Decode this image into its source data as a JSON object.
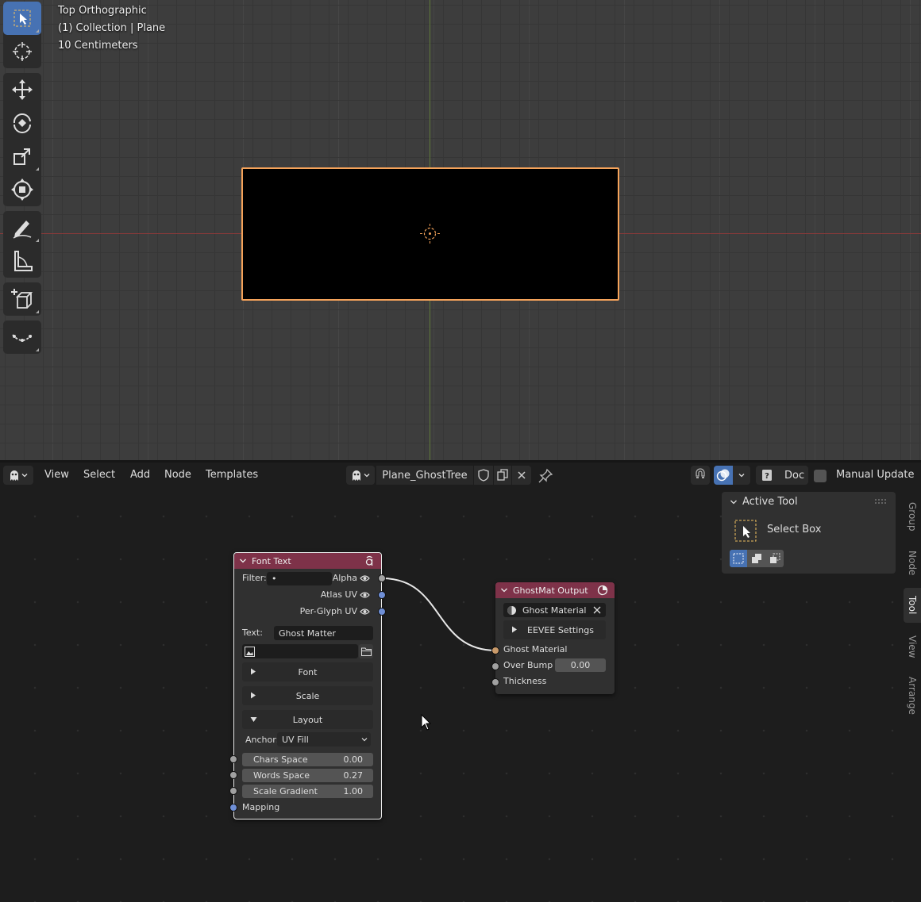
{
  "viewport": {
    "view_name": "Top Orthographic",
    "collection_info": "(1) Collection | Plane",
    "scale": "10 Centimeters"
  },
  "toolbar": {
    "tools": [
      "select-box-icon",
      "cursor-icon",
      "move-icon",
      "rotate-icon",
      "scale-icon",
      "transform-icon",
      "annotate-icon",
      "measure-icon",
      "add-cube-icon",
      "extrude-curve-icon"
    ]
  },
  "node_editor": {
    "menu": {
      "view": "View",
      "select": "Select",
      "add": "Add",
      "node": "Node",
      "templates": "Templates"
    },
    "tree_name": "Plane_GhostTree",
    "doc_label": "Doc",
    "manual_update_label": "Manual Update",
    "colors": {
      "node_header": "#7e3249",
      "selection": "#4772b3",
      "plane_outline": "#f5a35a"
    }
  },
  "font_text_node": {
    "title": "Font Text",
    "filter_label": "Filter:",
    "filter_value": "•",
    "outputs": [
      "Alpha",
      "Atlas UV",
      "Per-Glyph UV"
    ],
    "text_label": "Text:",
    "text_value": "Ghost Matter",
    "panels": {
      "font": "Font",
      "scale": "Scale",
      "layout": "Layout"
    },
    "anchor_label": "Anchor:",
    "anchor_value": "UV Fill",
    "sliders": [
      {
        "label": "Chars Space",
        "value": "0.00"
      },
      {
        "label": "Words Space",
        "value": "0.27"
      },
      {
        "label": "Scale Gradient",
        "value": "1.00"
      }
    ],
    "mapping_label": "Mapping"
  },
  "output_node": {
    "title": "GhostMat Output",
    "material": "Ghost Material",
    "eevee_label": "EEVEE Settings",
    "inputs": {
      "ghost_material": "Ghost Material",
      "over_bump": "Over Bump",
      "over_bump_value": "0.00",
      "thickness": "Thickness"
    }
  },
  "side_panel": {
    "title": "Active Tool",
    "tool_name": "Select Box",
    "tabs": [
      "Group",
      "Node",
      "Tool",
      "View",
      "Arrange"
    ],
    "active_tab": "Tool"
  }
}
